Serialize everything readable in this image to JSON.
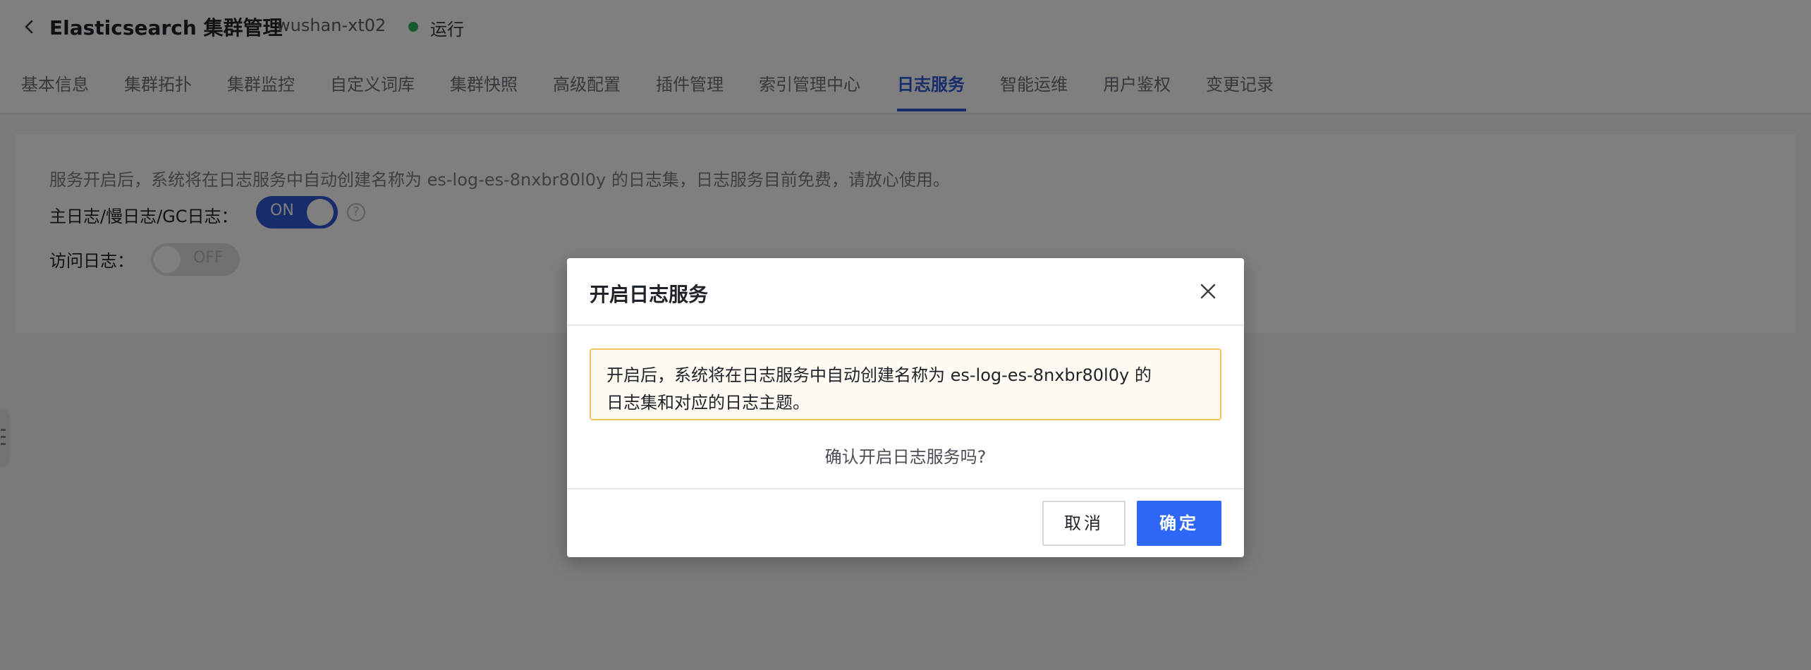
{
  "header": {
    "title": "Elasticsearch 集群管理",
    "cluster_id": "wushan-xt02",
    "status": "运行",
    "status_color": "#2fb55a"
  },
  "tabs": [
    {
      "label": "基本信息",
      "active": false
    },
    {
      "label": "集群拓扑",
      "active": false
    },
    {
      "label": "集群监控",
      "active": false
    },
    {
      "label": "自定义词库",
      "active": false
    },
    {
      "label": "集群快照",
      "active": false
    },
    {
      "label": "高级配置",
      "active": false
    },
    {
      "label": "插件管理",
      "active": false
    },
    {
      "label": "索引管理中心",
      "active": false
    },
    {
      "label": "日志服务",
      "active": true
    },
    {
      "label": "智能运维",
      "active": false
    },
    {
      "label": "用户鉴权",
      "active": false
    },
    {
      "label": "变更记录",
      "active": false
    }
  ],
  "log_service": {
    "info": "服务开启后，系统将在日志服务中自动创建名称为 es-log-es-8nxbr80l0y 的日志集，日志服务目前免费，请放心使用。",
    "main_log_label": "主日志/慢日志/GC日志：",
    "main_log_toggle": "ON",
    "main_log_enabled": true,
    "help_icon_glyph": "?",
    "access_log_label": "访问日志：",
    "access_log_toggle": "OFF",
    "access_log_enabled": false
  },
  "modal": {
    "title": "开启日志服务",
    "alert_line1": "开启后，系统将在日志服务中自动创建名称为 es-log-es-8nxbr80l0y 的",
    "alert_line2": "日志集和对应的日志主题。",
    "confirm_question": "确认开启日志服务吗?",
    "cancel_label": "取消",
    "ok_label": "确定"
  },
  "colors": {
    "accent": "#2e58d6",
    "primary_button": "#2e67f6",
    "alert_border": "#f3c45c",
    "alert_bg": "#fffbf2"
  },
  "icons": {
    "back": "chevron-left-icon",
    "close": "close-icon",
    "help": "question-circle-icon",
    "side_handle": "grip-icon"
  }
}
